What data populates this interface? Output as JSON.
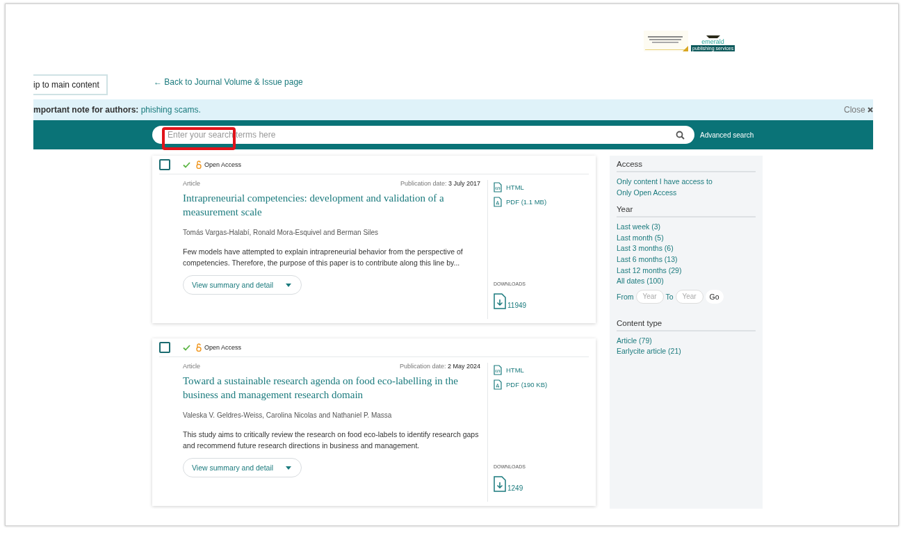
{
  "logo": {
    "name": "emerald",
    "tagline": "publishing services"
  },
  "skip_link": "ip to main content",
  "back_link": "← Back to Journal Volume & Issue page",
  "notice": {
    "label": "mportant note for authors:",
    "link": "phishing scams.",
    "close": "Close"
  },
  "search": {
    "placeholder": "Enter your search terms here",
    "highlighted": true
  },
  "advanced_search": "Advanced search",
  "results": [
    {
      "checked": false,
      "access": "Open Access",
      "type": "Article",
      "date_label": "Publication date:",
      "date": "3 July 2017",
      "title": "Intrapreneurial competencies: development and validation of a measurement scale",
      "authors": "Tomás Vargas-Halabí, Ronald Mora-Esquivel and Berman Siles",
      "abstract": "Few models have attempted to explain intrapreneurial behavior from the perspective of competencies. Therefore, the purpose of this paper is to contribute along this line by...",
      "action": "View summary and detail",
      "formats": [
        "HTML",
        "PDF (1.1 MB)"
      ],
      "downloads_label": "DOWNLOADS",
      "downloads": "11949"
    },
    {
      "checked": false,
      "access": "Open Access",
      "type": "Article",
      "date_label": "Publication date:",
      "date": "2 May 2024",
      "title": "Toward a sustainable research agenda on food eco-labelling in the business and management research domain",
      "authors": "Valeska V. Geldres-Weiss, Carolina Nicolas and Nathaniel P. Massa",
      "abstract": "This study aims to critically review the research on food eco-labels to identify research gaps and recommend future research directions in business and management.",
      "action": "View summary and detail",
      "formats": [
        "HTML",
        "PDF (190 KB)"
      ],
      "downloads_label": "DOWNLOADS",
      "downloads": "1249"
    }
  ],
  "filters": [
    {
      "heading": "Access",
      "items": [
        "Only content I have access to",
        "Only Open Access"
      ]
    },
    {
      "heading": "Year",
      "items": [
        "Last week (3)",
        "Last month (5)",
        "Last 3 months (6)",
        "Last 6 months (13)",
        "Last 12 months (29)",
        "All dates (100)"
      ],
      "range": {
        "from": "From",
        "from_placeholder": "Year",
        "to": "To",
        "to_placeholder": "Year",
        "go": "Go"
      }
    },
    {
      "heading": "Content type",
      "items": [
        "Article (79)",
        "Earlycite article (21)"
      ]
    }
  ]
}
